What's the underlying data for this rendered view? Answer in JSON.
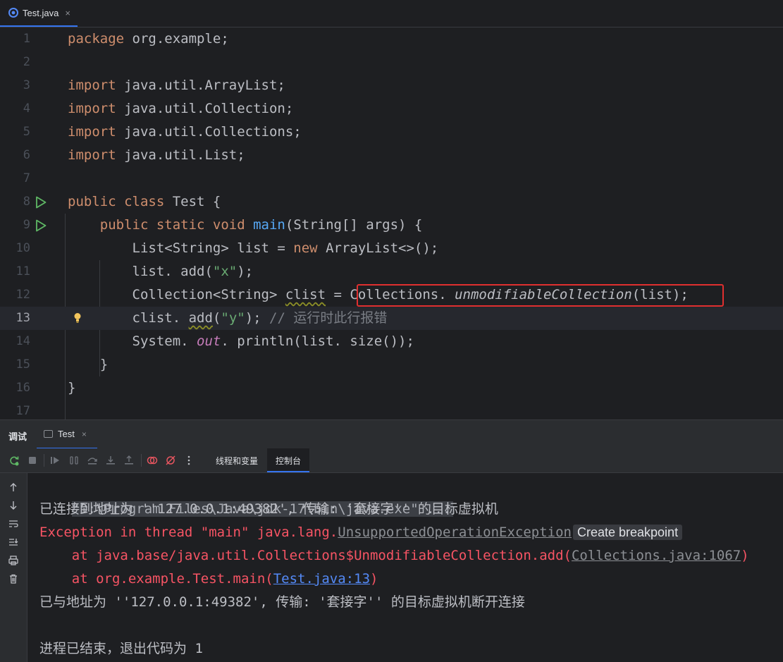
{
  "editor_tab": {
    "label": "Test.java",
    "close": "×"
  },
  "code_lines": [
    {
      "n": "1"
    },
    {
      "n": "2"
    },
    {
      "n": "3"
    },
    {
      "n": "4"
    },
    {
      "n": "5"
    },
    {
      "n": "6"
    },
    {
      "n": "7"
    },
    {
      "n": "8"
    },
    {
      "n": "9"
    },
    {
      "n": "10"
    },
    {
      "n": "11"
    },
    {
      "n": "12"
    },
    {
      "n": "13"
    },
    {
      "n": "14"
    },
    {
      "n": "15"
    },
    {
      "n": "16"
    },
    {
      "n": "17"
    }
  ],
  "code": {
    "l1": {
      "kw": "package",
      "rest": " org.example;"
    },
    "l3": {
      "kw": "import",
      "rest": " java.util.ArrayList;"
    },
    "l4": {
      "kw": "import",
      "rest": " java.util.Collection;"
    },
    "l5": {
      "kw": "import",
      "rest": " java.util.Collections;"
    },
    "l6": {
      "kw": "import",
      "rest": " java.util.List;"
    },
    "l8": {
      "kw": "public class",
      "rest": " Test {"
    },
    "l9": {
      "kw": "    public static void",
      "fn": " main",
      "rest": "(String[] args) {"
    },
    "l10": {
      "pre": "        List<String> list = ",
      "kw": "new",
      "rest": " ArrayList<>();"
    },
    "l11": {
      "pre": "        list. add(",
      "str": "\"x\"",
      "rest": ");"
    },
    "l12": {
      "pre": "        Collection<String> ",
      "var": "clist",
      "mid": " = ",
      "cls": "Collections. ",
      "call": "unmodifiableCollection",
      "rest": "(list);"
    },
    "l13": {
      "pre": "        clist. ",
      "method": "add",
      "open": "(",
      "str": "\"y\"",
      "close": "); ",
      "comment": "// 运行时此行报错"
    },
    "l14": {
      "pre": "        System. ",
      "field": "out",
      "rest": ". println(list. size());"
    },
    "l15": {
      "rest": "    }"
    },
    "l16": {
      "rest": "}"
    }
  },
  "tool_window": {
    "title": "调试",
    "run_tab": "Test",
    "run_tab_close": "×",
    "subtabs": {
      "threads": "线程和变量",
      "console": "控制台"
    }
  },
  "console": {
    "cmd": "\"D:\\Program Files\\Java\\jdk-17\\bin\\java.exe\" ...",
    "connected": "已连接到地址为 ''127.0.0.1:49382', 传输: '套接字'' 的目标虚拟机",
    "exc_prefix": "Exception in thread \"main\" java.lang.",
    "exc_class": "UnsupportedOperationException",
    "badge": "Create breakpoint",
    "at1_prefix": "    at java.base/java.util.Collections$UnmodifiableCollection.add(",
    "at1_link": "Collections.java:1067",
    "at1_suffix": ")",
    "at2_prefix": "    at org.example.Test.main(",
    "at2_link": "Test.java:13",
    "at2_suffix": ")",
    "disconnected": "已与地址为 ''127.0.0.1:49382', 传输: '套接字'' 的目标虚拟机断开连接",
    "finished": "进程已结束，退出代码为 1"
  }
}
